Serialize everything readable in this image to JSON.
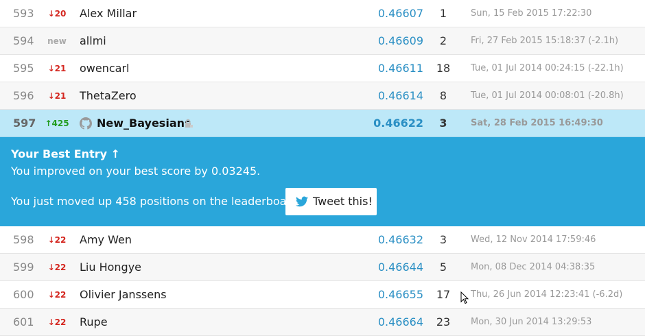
{
  "colors": {
    "accent": "#2a8fc4",
    "banner_bg": "#2aa6da",
    "highlight_row": "#bde8f8",
    "down": "#d4261f",
    "up": "#219b1d"
  },
  "rows_before": [
    {
      "rank": "593",
      "delta": "↓20",
      "delta_dir": "down",
      "team": "Alex Millar",
      "score": "0.46607",
      "entries": "1",
      "last": "Sun, 15 Feb 2015 17:22:30"
    },
    {
      "rank": "594",
      "delta": "new",
      "delta_dir": "new",
      "team": "allmi",
      "score": "0.46609",
      "entries": "2",
      "last": "Fri, 27 Feb 2015 15:18:37 (-2.1h)"
    },
    {
      "rank": "595",
      "delta": "↓21",
      "delta_dir": "down",
      "team": "owencarl",
      "score": "0.46611",
      "entries": "18",
      "last": "Tue, 01 Jul 2014 00:24:15 (-22.1h)"
    },
    {
      "rank": "596",
      "delta": "↓21",
      "delta_dir": "down",
      "team": "ThetaZero",
      "score": "0.46614",
      "entries": "8",
      "last": "Tue, 01 Jul 2014 00:08:01 (-20.8h)"
    }
  ],
  "highlight_row": {
    "rank": "597",
    "delta": "↑425",
    "delta_dir": "up",
    "team": "New_Bayesians",
    "score": "0.46622",
    "entries": "3",
    "last": "Sat, 28 Feb 2015 16:49:30",
    "icon": "github-icon",
    "badge_icon": "lock-icon"
  },
  "banner": {
    "title": "Your Best Entry ↑",
    "line1": "You improved on your best score by 0.03245.",
    "line2": "You just moved up 458 positions on the leaderboard.",
    "tweet_label": "Tweet this!",
    "tweet_icon": "twitter-bird-icon"
  },
  "rows_after": [
    {
      "rank": "598",
      "delta": "↓22",
      "delta_dir": "down",
      "team": "Amy Wen",
      "score": "0.46632",
      "entries": "3",
      "last": "Wed, 12 Nov 2014 17:59:46"
    },
    {
      "rank": "599",
      "delta": "↓22",
      "delta_dir": "down",
      "team": "Liu Hongye",
      "score": "0.46644",
      "entries": "5",
      "last": "Mon, 08 Dec 2014 04:38:35"
    },
    {
      "rank": "600",
      "delta": "↓22",
      "delta_dir": "down",
      "team": "Olivier Janssens",
      "score": "0.46655",
      "entries": "17",
      "last": "Thu, 26 Jun 2014 12:23:41 (-6.2d)"
    },
    {
      "rank": "601",
      "delta": "↓22",
      "delta_dir": "down",
      "team": "Rupe",
      "score": "0.46664",
      "entries": "23",
      "last": "Mon, 30 Jun 2014 13:29:53"
    }
  ]
}
